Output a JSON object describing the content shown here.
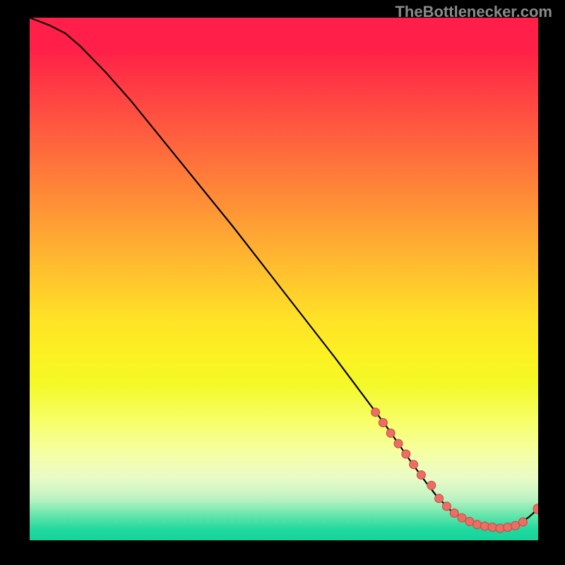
{
  "watermark": "TheBottlenecker.com",
  "colors": {
    "curve": "#000000",
    "marker_fill": "#eb6d63",
    "marker_stroke": "#c14b44",
    "background": "#000000"
  },
  "chart_data": {
    "type": "line",
    "title": "",
    "xlabel": "",
    "ylabel": "",
    "xlim": [
      0,
      100
    ],
    "ylim": [
      0,
      100
    ],
    "grid": false,
    "legend": false,
    "x": [
      0,
      4,
      7,
      10,
      15,
      20,
      30,
      40,
      50,
      60,
      65,
      70,
      75,
      78,
      80,
      83,
      85,
      88,
      90,
      92,
      94,
      96,
      98,
      100
    ],
    "values": [
      100,
      98.5,
      97,
      94.5,
      89.5,
      84,
      72,
      60,
      47.5,
      35,
      28.5,
      22,
      15,
      11,
      8.5,
      5.5,
      4.3,
      3.0,
      2.5,
      2.3,
      2.5,
      3.2,
      4.3,
      6.0
    ],
    "markers": {
      "scatter_x": [
        68,
        69.5,
        71,
        72.5,
        74,
        75.5,
        77,
        79,
        80.5,
        82,
        83.5,
        85,
        86.5,
        88,
        89.5,
        91,
        92.5,
        94,
        95.5,
        97,
        100
      ],
      "scatter_y": [
        24.5,
        22.5,
        20.5,
        18.5,
        16.5,
        14.5,
        12.5,
        10.5,
        8.0,
        6.5,
        5.2,
        4.3,
        3.6,
        3.0,
        2.7,
        2.5,
        2.3,
        2.5,
        2.8,
        3.5,
        6.0
      ]
    }
  }
}
